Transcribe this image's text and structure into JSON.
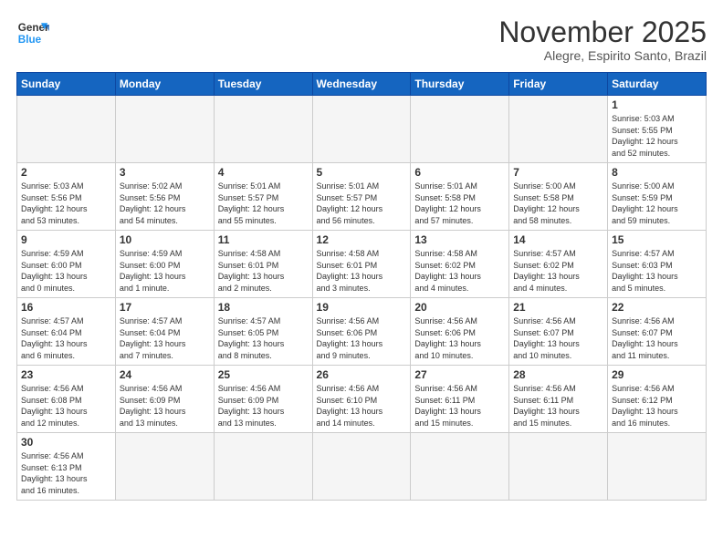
{
  "header": {
    "logo_line1": "General",
    "logo_line2": "Blue",
    "month": "November 2025",
    "location": "Alegre, Espirito Santo, Brazil"
  },
  "weekdays": [
    "Sunday",
    "Monday",
    "Tuesday",
    "Wednesday",
    "Thursday",
    "Friday",
    "Saturday"
  ],
  "weeks": [
    [
      {
        "day": "",
        "info": "",
        "empty": true
      },
      {
        "day": "",
        "info": "",
        "empty": true
      },
      {
        "day": "",
        "info": "",
        "empty": true
      },
      {
        "day": "",
        "info": "",
        "empty": true
      },
      {
        "day": "",
        "info": "",
        "empty": true
      },
      {
        "day": "",
        "info": "",
        "empty": true
      },
      {
        "day": "1",
        "info": "Sunrise: 5:03 AM\nSunset: 5:55 PM\nDaylight: 12 hours\nand 52 minutes."
      }
    ],
    [
      {
        "day": "2",
        "info": "Sunrise: 5:03 AM\nSunset: 5:56 PM\nDaylight: 12 hours\nand 53 minutes."
      },
      {
        "day": "3",
        "info": "Sunrise: 5:02 AM\nSunset: 5:56 PM\nDaylight: 12 hours\nand 54 minutes."
      },
      {
        "day": "4",
        "info": "Sunrise: 5:01 AM\nSunset: 5:57 PM\nDaylight: 12 hours\nand 55 minutes."
      },
      {
        "day": "5",
        "info": "Sunrise: 5:01 AM\nSunset: 5:57 PM\nDaylight: 12 hours\nand 56 minutes."
      },
      {
        "day": "6",
        "info": "Sunrise: 5:01 AM\nSunset: 5:58 PM\nDaylight: 12 hours\nand 57 minutes."
      },
      {
        "day": "7",
        "info": "Sunrise: 5:00 AM\nSunset: 5:58 PM\nDaylight: 12 hours\nand 58 minutes."
      },
      {
        "day": "8",
        "info": "Sunrise: 5:00 AM\nSunset: 5:59 PM\nDaylight: 12 hours\nand 59 minutes."
      }
    ],
    [
      {
        "day": "9",
        "info": "Sunrise: 4:59 AM\nSunset: 6:00 PM\nDaylight: 13 hours\nand 0 minutes."
      },
      {
        "day": "10",
        "info": "Sunrise: 4:59 AM\nSunset: 6:00 PM\nDaylight: 13 hours\nand 1 minute."
      },
      {
        "day": "11",
        "info": "Sunrise: 4:58 AM\nSunset: 6:01 PM\nDaylight: 13 hours\nand 2 minutes."
      },
      {
        "day": "12",
        "info": "Sunrise: 4:58 AM\nSunset: 6:01 PM\nDaylight: 13 hours\nand 3 minutes."
      },
      {
        "day": "13",
        "info": "Sunrise: 4:58 AM\nSunset: 6:02 PM\nDaylight: 13 hours\nand 4 minutes."
      },
      {
        "day": "14",
        "info": "Sunrise: 4:57 AM\nSunset: 6:02 PM\nDaylight: 13 hours\nand 4 minutes."
      },
      {
        "day": "15",
        "info": "Sunrise: 4:57 AM\nSunset: 6:03 PM\nDaylight: 13 hours\nand 5 minutes."
      }
    ],
    [
      {
        "day": "16",
        "info": "Sunrise: 4:57 AM\nSunset: 6:04 PM\nDaylight: 13 hours\nand 6 minutes."
      },
      {
        "day": "17",
        "info": "Sunrise: 4:57 AM\nSunset: 6:04 PM\nDaylight: 13 hours\nand 7 minutes."
      },
      {
        "day": "18",
        "info": "Sunrise: 4:57 AM\nSunset: 6:05 PM\nDaylight: 13 hours\nand 8 minutes."
      },
      {
        "day": "19",
        "info": "Sunrise: 4:56 AM\nSunset: 6:06 PM\nDaylight: 13 hours\nand 9 minutes."
      },
      {
        "day": "20",
        "info": "Sunrise: 4:56 AM\nSunset: 6:06 PM\nDaylight: 13 hours\nand 10 minutes."
      },
      {
        "day": "21",
        "info": "Sunrise: 4:56 AM\nSunset: 6:07 PM\nDaylight: 13 hours\nand 10 minutes."
      },
      {
        "day": "22",
        "info": "Sunrise: 4:56 AM\nSunset: 6:07 PM\nDaylight: 13 hours\nand 11 minutes."
      }
    ],
    [
      {
        "day": "23",
        "info": "Sunrise: 4:56 AM\nSunset: 6:08 PM\nDaylight: 13 hours\nand 12 minutes."
      },
      {
        "day": "24",
        "info": "Sunrise: 4:56 AM\nSunset: 6:09 PM\nDaylight: 13 hours\nand 13 minutes."
      },
      {
        "day": "25",
        "info": "Sunrise: 4:56 AM\nSunset: 6:09 PM\nDaylight: 13 hours\nand 13 minutes."
      },
      {
        "day": "26",
        "info": "Sunrise: 4:56 AM\nSunset: 6:10 PM\nDaylight: 13 hours\nand 14 minutes."
      },
      {
        "day": "27",
        "info": "Sunrise: 4:56 AM\nSunset: 6:11 PM\nDaylight: 13 hours\nand 15 minutes."
      },
      {
        "day": "28",
        "info": "Sunrise: 4:56 AM\nSunset: 6:11 PM\nDaylight: 13 hours\nand 15 minutes."
      },
      {
        "day": "29",
        "info": "Sunrise: 4:56 AM\nSunset: 6:12 PM\nDaylight: 13 hours\nand 16 minutes."
      }
    ],
    [
      {
        "day": "30",
        "info": "Sunrise: 4:56 AM\nSunset: 6:13 PM\nDaylight: 13 hours\nand 16 minutes."
      },
      {
        "day": "",
        "info": "",
        "empty": true
      },
      {
        "day": "",
        "info": "",
        "empty": true
      },
      {
        "day": "",
        "info": "",
        "empty": true
      },
      {
        "day": "",
        "info": "",
        "empty": true
      },
      {
        "day": "",
        "info": "",
        "empty": true
      },
      {
        "day": "",
        "info": "",
        "empty": true
      }
    ]
  ]
}
